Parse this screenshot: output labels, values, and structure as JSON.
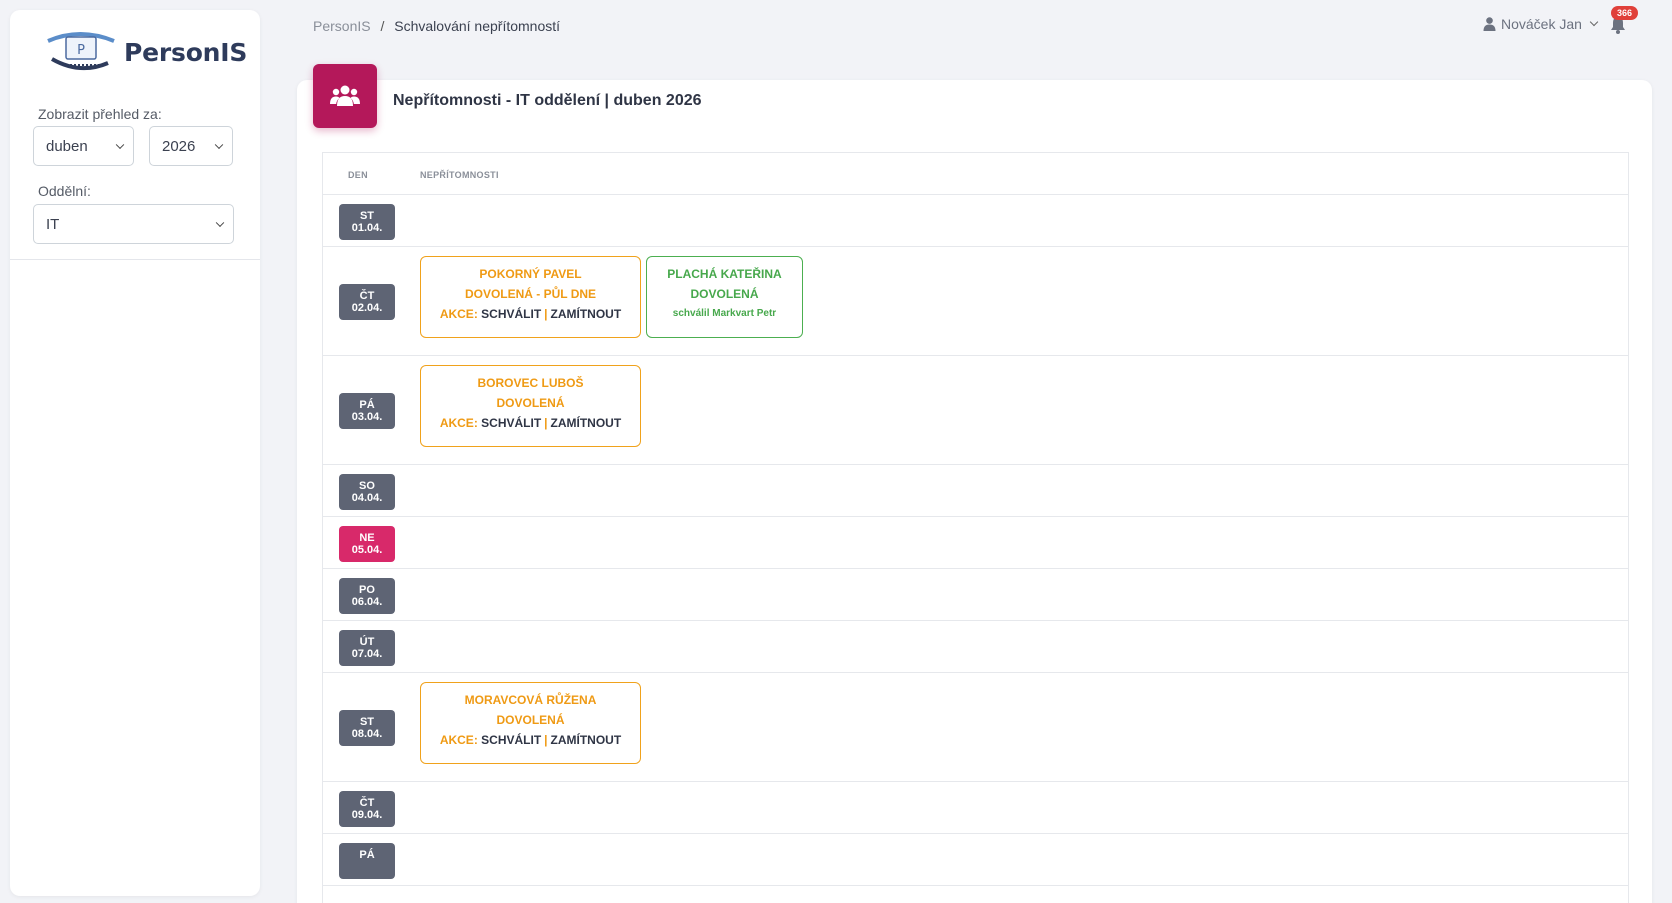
{
  "brand": {
    "name": "PersonIS",
    "logo_letter": "P"
  },
  "sidebar": {
    "period_label": "Zobrazit přehled za:",
    "month": "duben",
    "year": "2026",
    "department_label": "Oddělní:",
    "department": "IT"
  },
  "breadcrumb": {
    "root": "PersonIS",
    "separator": "/",
    "current": "Schvalování nepřítomností"
  },
  "user": {
    "name": "Nováček Jan",
    "notifications": "366"
  },
  "card": {
    "title": "Nepřítomnosti - IT oddělení | duben 2026"
  },
  "table": {
    "headers": {
      "day": "DEN",
      "absences": "NEPŘÍTOMNOSTI"
    },
    "rows": [
      {
        "dow": "ST",
        "date": "01.04.",
        "sunday": false,
        "absences": []
      },
      {
        "dow": "ČT",
        "date": "02.04.",
        "sunday": false,
        "absences": [
          {
            "status": "pending",
            "name": "POKORNÝ PAVEL",
            "type": "DOVOLENÁ - PŮL DNE",
            "actions_label": "AKCE:",
            "approve": "SCHVÁLIT",
            "reject": "ZAMÍTNOUT"
          },
          {
            "status": "approved",
            "name": "PLACHÁ KATEŘINA",
            "type": "DOVOLENÁ",
            "note": "schválil Markvart Petr"
          }
        ]
      },
      {
        "dow": "PÁ",
        "date": "03.04.",
        "sunday": false,
        "absences": [
          {
            "status": "pending",
            "name": "BOROVEC LUBOŠ",
            "type": "DOVOLENÁ",
            "actions_label": "AKCE:",
            "approve": "SCHVÁLIT",
            "reject": "ZAMÍTNOUT"
          }
        ]
      },
      {
        "dow": "SO",
        "date": "04.04.",
        "sunday": false,
        "absences": []
      },
      {
        "dow": "NE",
        "date": "05.04.",
        "sunday": true,
        "absences": []
      },
      {
        "dow": "PO",
        "date": "06.04.",
        "sunday": false,
        "absences": []
      },
      {
        "dow": "ÚT",
        "date": "07.04.",
        "sunday": false,
        "absences": []
      },
      {
        "dow": "ST",
        "date": "08.04.",
        "sunday": false,
        "absences": [
          {
            "status": "pending",
            "name": "MORAVCOVÁ RŮŽENA",
            "type": "DOVOLENÁ",
            "actions_label": "AKCE:",
            "approve": "SCHVÁLIT",
            "reject": "ZAMÍTNOUT"
          }
        ]
      },
      {
        "dow": "ČT",
        "date": "09.04.",
        "sunday": false,
        "absences": []
      },
      {
        "dow": "PÁ",
        "date": "",
        "sunday": false,
        "absences": []
      }
    ]
  },
  "colors": {
    "accent": "#b4185a",
    "pending": "#ef9a14",
    "approved": "#47a84c",
    "sunday": "#d8296a",
    "day_badge": "#5e6474"
  }
}
